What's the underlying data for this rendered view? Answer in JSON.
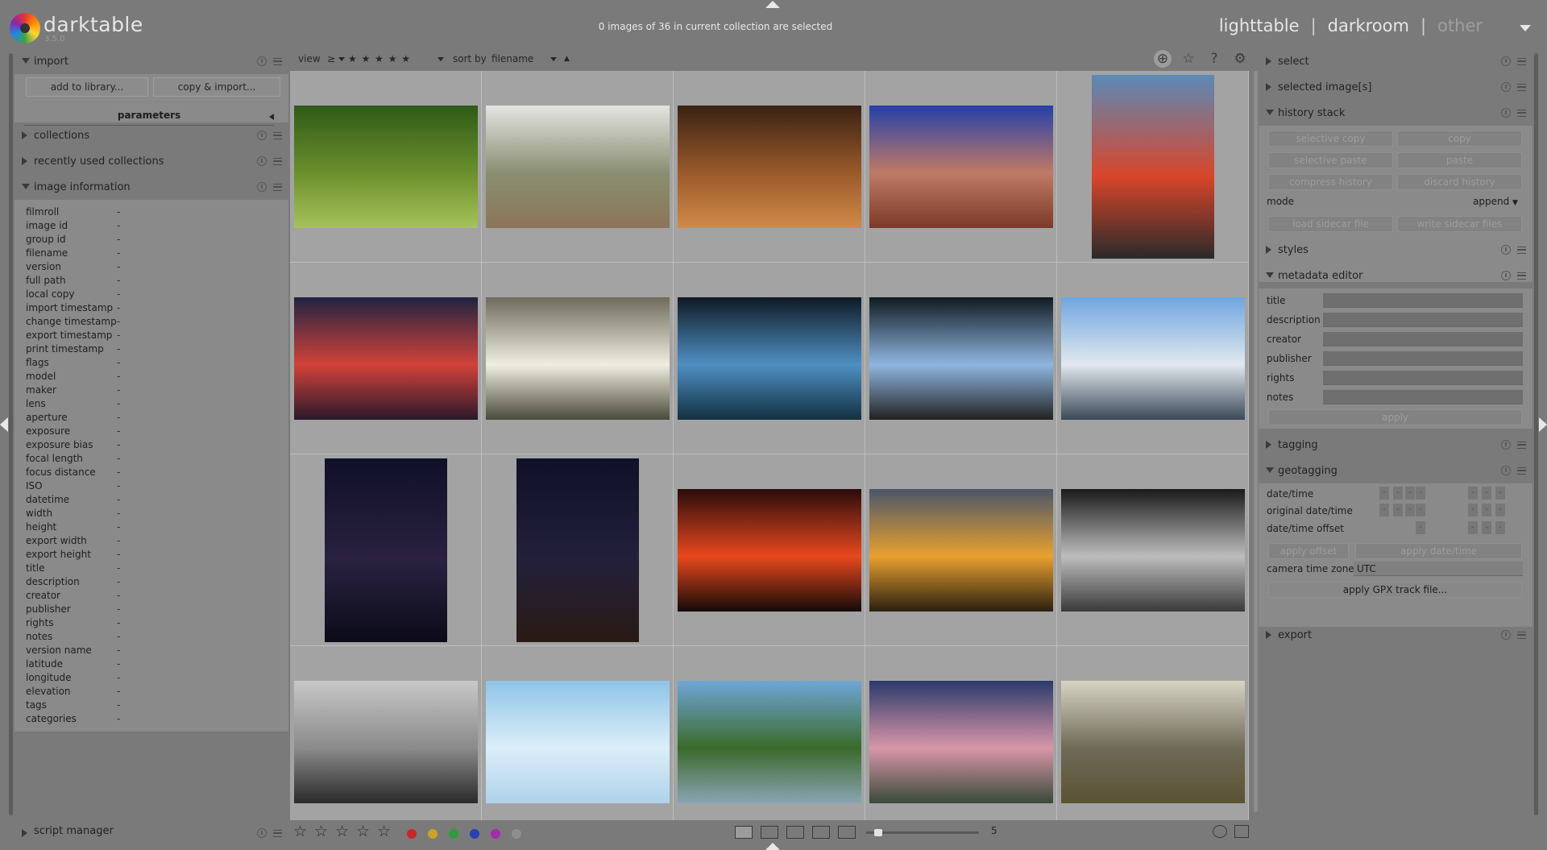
{
  "app": {
    "name": "darktable",
    "version": "3.5.0"
  },
  "header": {
    "selection_status": "0 images of 36 in current collection are selected",
    "views": {
      "lighttable": "lighttable",
      "sep": "|",
      "darkroom": "darkroom",
      "other": "other"
    }
  },
  "left": {
    "import": {
      "title": "import",
      "add_button": "add to library...",
      "copy_button": "copy & import...",
      "parameters": "parameters"
    },
    "collections": {
      "title": "collections"
    },
    "recent": {
      "title": "recently used collections"
    },
    "info": {
      "title": "image information",
      "rows": [
        {
          "k": "filmroll",
          "v": "-"
        },
        {
          "k": "image id",
          "v": "-"
        },
        {
          "k": "group id",
          "v": "-"
        },
        {
          "k": "filename",
          "v": "-"
        },
        {
          "k": "version",
          "v": "-"
        },
        {
          "k": "full path",
          "v": "-"
        },
        {
          "k": "local copy",
          "v": "-"
        },
        {
          "k": "import timestamp",
          "v": "-"
        },
        {
          "k": "change timestamp",
          "v": "-"
        },
        {
          "k": "export timestamp",
          "v": "-"
        },
        {
          "k": "print timestamp",
          "v": "-"
        },
        {
          "k": "flags",
          "v": "-"
        },
        {
          "k": "model",
          "v": "-"
        },
        {
          "k": "maker",
          "v": "-"
        },
        {
          "k": "lens",
          "v": "-"
        },
        {
          "k": "aperture",
          "v": "-"
        },
        {
          "k": "exposure",
          "v": "-"
        },
        {
          "k": "exposure bias",
          "v": "-"
        },
        {
          "k": "focal length",
          "v": "-"
        },
        {
          "k": "focus distance",
          "v": "-"
        },
        {
          "k": "ISO",
          "v": "-"
        },
        {
          "k": "datetime",
          "v": "-"
        },
        {
          "k": "width",
          "v": "-"
        },
        {
          "k": "height",
          "v": "-"
        },
        {
          "k": "export width",
          "v": "-"
        },
        {
          "k": "export height",
          "v": "-"
        },
        {
          "k": "title",
          "v": "-"
        },
        {
          "k": "description",
          "v": "-"
        },
        {
          "k": "creator",
          "v": "-"
        },
        {
          "k": "publisher",
          "v": "-"
        },
        {
          "k": "rights",
          "v": "-"
        },
        {
          "k": "notes",
          "v": "-"
        },
        {
          "k": "version name",
          "v": "-"
        },
        {
          "k": "latitude",
          "v": "-"
        },
        {
          "k": "longitude",
          "v": "-"
        },
        {
          "k": "elevation",
          "v": "-"
        },
        {
          "k": "tags",
          "v": "-"
        },
        {
          "k": "categories",
          "v": "-"
        }
      ]
    },
    "script_manager": "script manager"
  },
  "filterbar": {
    "view_label": "view",
    "view_op": "≥",
    "stars": "★ ★ ★ ★ ★",
    "sort_label": "sort by",
    "sort_value": "filename",
    "sort_dir": "▲"
  },
  "thumbnails": [
    {
      "colors": [
        "#2f5a17",
        "#6b8f2c",
        "#a6c35a"
      ],
      "portrait": false
    },
    {
      "colors": [
        "#e4e4e2",
        "#8a8f72",
        "#8b7558"
      ],
      "portrait": false
    },
    {
      "colors": [
        "#3a2214",
        "#9a5a2a",
        "#d08a48"
      ],
      "portrait": false
    },
    {
      "colors": [
        "#2540a8",
        "#c07a66",
        "#7c3a28"
      ],
      "portrait": false
    },
    {
      "colors": [
        "#5a8ab8",
        "#d8462a",
        "#2a2a2a"
      ],
      "portrait": true
    },
    {
      "colors": [
        "#1f2442",
        "#d2413a",
        "#2a1a2a"
      ],
      "portrait": false
    },
    {
      "colors": [
        "#6f6b5c",
        "#efeee0",
        "#4a4a3a"
      ],
      "portrait": false
    },
    {
      "colors": [
        "#0e1a24",
        "#4f8fc4",
        "#123040"
      ],
      "portrait": false
    },
    {
      "colors": [
        "#101a20",
        "#8fb6e0",
        "#222"
      ],
      "portrait": false
    },
    {
      "colors": [
        "#6fa6e0",
        "#e2e8ee",
        "#3a4a58"
      ],
      "portrait": false
    },
    {
      "colors": [
        "#0f0f28",
        "#2a2240",
        "#0b0b18"
      ],
      "portrait": true
    },
    {
      "colors": [
        "#101028",
        "#22203a",
        "#2a1a14"
      ],
      "portrait": true
    },
    {
      "colors": [
        "#2a0c0c",
        "#e8481e",
        "#140a08"
      ],
      "portrait": false
    },
    {
      "colors": [
        "#4a5668",
        "#e8a030",
        "#2a2010"
      ],
      "portrait": false
    },
    {
      "colors": [
        "#1a1a1a",
        "#bdbdbd",
        "#3a3a3a"
      ],
      "portrait": false
    },
    {
      "colors": [
        "#c8c8c8",
        "#8a8a8a",
        "#2a2a2a"
      ],
      "portrait": false
    },
    {
      "colors": [
        "#8ec4e8",
        "#dceef8",
        "#aed2ea"
      ],
      "portrait": false
    },
    {
      "colors": [
        "#6fa6d8",
        "#3a6a2a",
        "#8aa4b4"
      ],
      "portrait": false
    },
    {
      "colors": [
        "#2a3a6a",
        "#d896a8",
        "#3a4a3a"
      ],
      "portrait": false
    },
    {
      "colors": [
        "#d8d4c4",
        "#6f6a58",
        "#5a5232"
      ],
      "portrait": false
    }
  ],
  "bottombar": {
    "zoom_value": "5"
  },
  "right": {
    "select": {
      "title": "select"
    },
    "selected": {
      "title": "selected image[s]"
    },
    "history": {
      "title": "history stack",
      "selective_copy": "selective copy",
      "copy": "copy",
      "selective_paste": "selective paste",
      "paste": "paste",
      "compress": "compress history",
      "discard": "discard history",
      "mode_label": "mode",
      "mode_value": "append",
      "load_sidecar": "load sidecar file",
      "write_sidecar": "write sidecar files"
    },
    "styles": {
      "title": "styles"
    },
    "metadata": {
      "title": "metadata editor",
      "fields": [
        "title",
        "description",
        "creator",
        "publisher",
        "rights",
        "notes"
      ],
      "apply": "apply"
    },
    "tagging": {
      "title": "tagging"
    },
    "geotagging": {
      "title": "geotagging",
      "datetime": "date/time",
      "original": "original date/time",
      "offset": "date/time offset",
      "apply_offset": "apply offset",
      "apply_datetime": "apply date/time",
      "tz_label": "camera time zone",
      "tz_value": "UTC",
      "gpx": "apply GPX track file..."
    },
    "export": {
      "title": "export"
    }
  }
}
